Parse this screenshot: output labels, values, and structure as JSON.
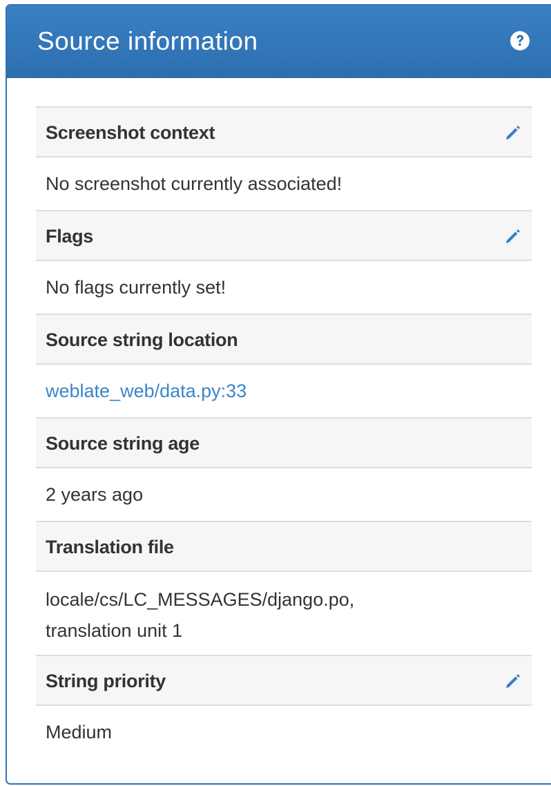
{
  "panel": {
    "title": "Source information",
    "help_icon": "question-circle-icon"
  },
  "colors": {
    "header_background": "#2c6fb0",
    "link": "#3a86c8",
    "edit_icon": "#3a7fc1"
  },
  "sections": [
    {
      "label": "Screenshot context",
      "value": "No screenshot currently associated!",
      "editable": true,
      "edit_icon": "pencil-icon"
    },
    {
      "label": "Flags",
      "value": "No flags currently set!",
      "editable": true,
      "edit_icon": "pencil-icon"
    },
    {
      "label": "Source string location",
      "value": "weblate_web/data.py:33",
      "is_link": true
    },
    {
      "label": "Source string age",
      "value": "2 years ago"
    },
    {
      "label": "Translation file",
      "value": "locale/cs/LC_MESSAGES/django.po, translation unit 1"
    },
    {
      "label": "String priority",
      "value": "Medium",
      "editable": true,
      "edit_icon": "pencil-icon"
    }
  ]
}
